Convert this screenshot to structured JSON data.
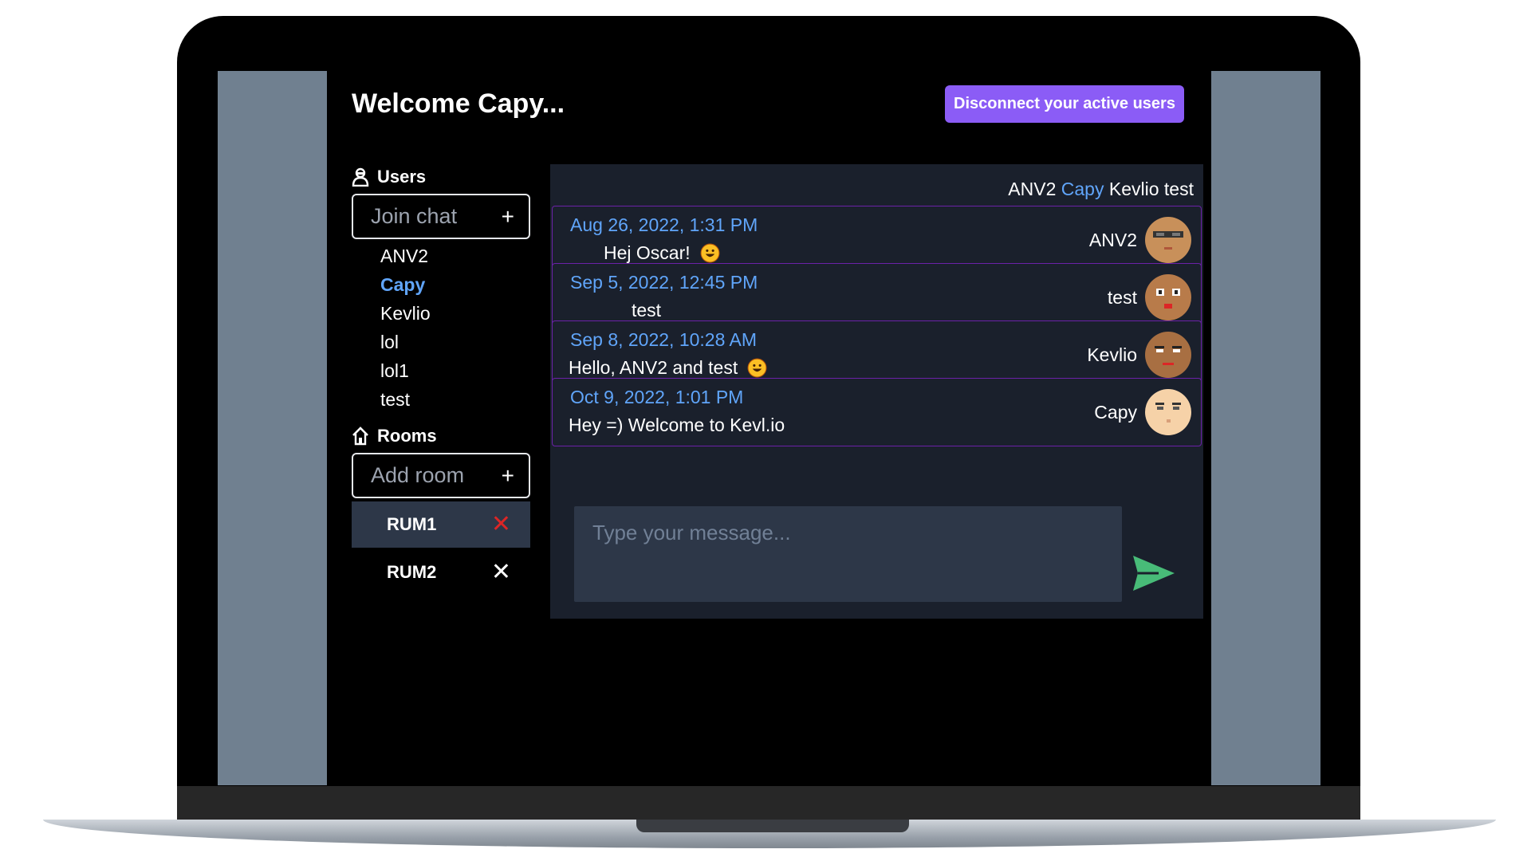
{
  "header": {
    "title": "Welcome Capy...",
    "disconnect_label": "Disconnect your active users"
  },
  "users": {
    "heading": "Users",
    "join_placeholder": "Join chat",
    "list": [
      "ANV2",
      "Capy",
      "Kevlio",
      "lol",
      "lol1",
      "test"
    ],
    "active_user": "Capy"
  },
  "rooms": {
    "heading": "Rooms",
    "add_placeholder": "Add room",
    "list": [
      {
        "name": "RUM1",
        "active": true
      },
      {
        "name": "RUM2",
        "active": false
      }
    ]
  },
  "chat": {
    "participants": [
      "ANV2",
      "Capy",
      "Kevlio",
      "test"
    ],
    "messages": [
      {
        "date": "Aug 26, 2022, 1:31 PM",
        "text": "Hej Oscar!",
        "emoji": true,
        "author": "ANV2"
      },
      {
        "date": "Sep 5, 2022, 12:45 PM",
        "text": "test",
        "emoji": false,
        "author": "test"
      },
      {
        "date": "Sep 8, 2022, 10:28 AM",
        "text": "Hello, ANV2 and test",
        "emoji": true,
        "author": "Kevlio"
      },
      {
        "date": "Oct 9, 2022, 1:01 PM",
        "text": "Hey =) Welcome to Kevl.io",
        "emoji": false,
        "author": "Capy"
      }
    ],
    "composer_placeholder": "Type your message..."
  },
  "colors": {
    "accent": "#8b5cf6",
    "link_blue": "#60a5fa",
    "send_green": "#48bb78",
    "message_border": "#6b21a8",
    "panel_bg": "#1a202c",
    "side_panel": "#708090"
  },
  "icons": [
    "user-icon",
    "house-icon",
    "plus-icon",
    "close-icon",
    "send-icon",
    "smiley-emoji"
  ]
}
